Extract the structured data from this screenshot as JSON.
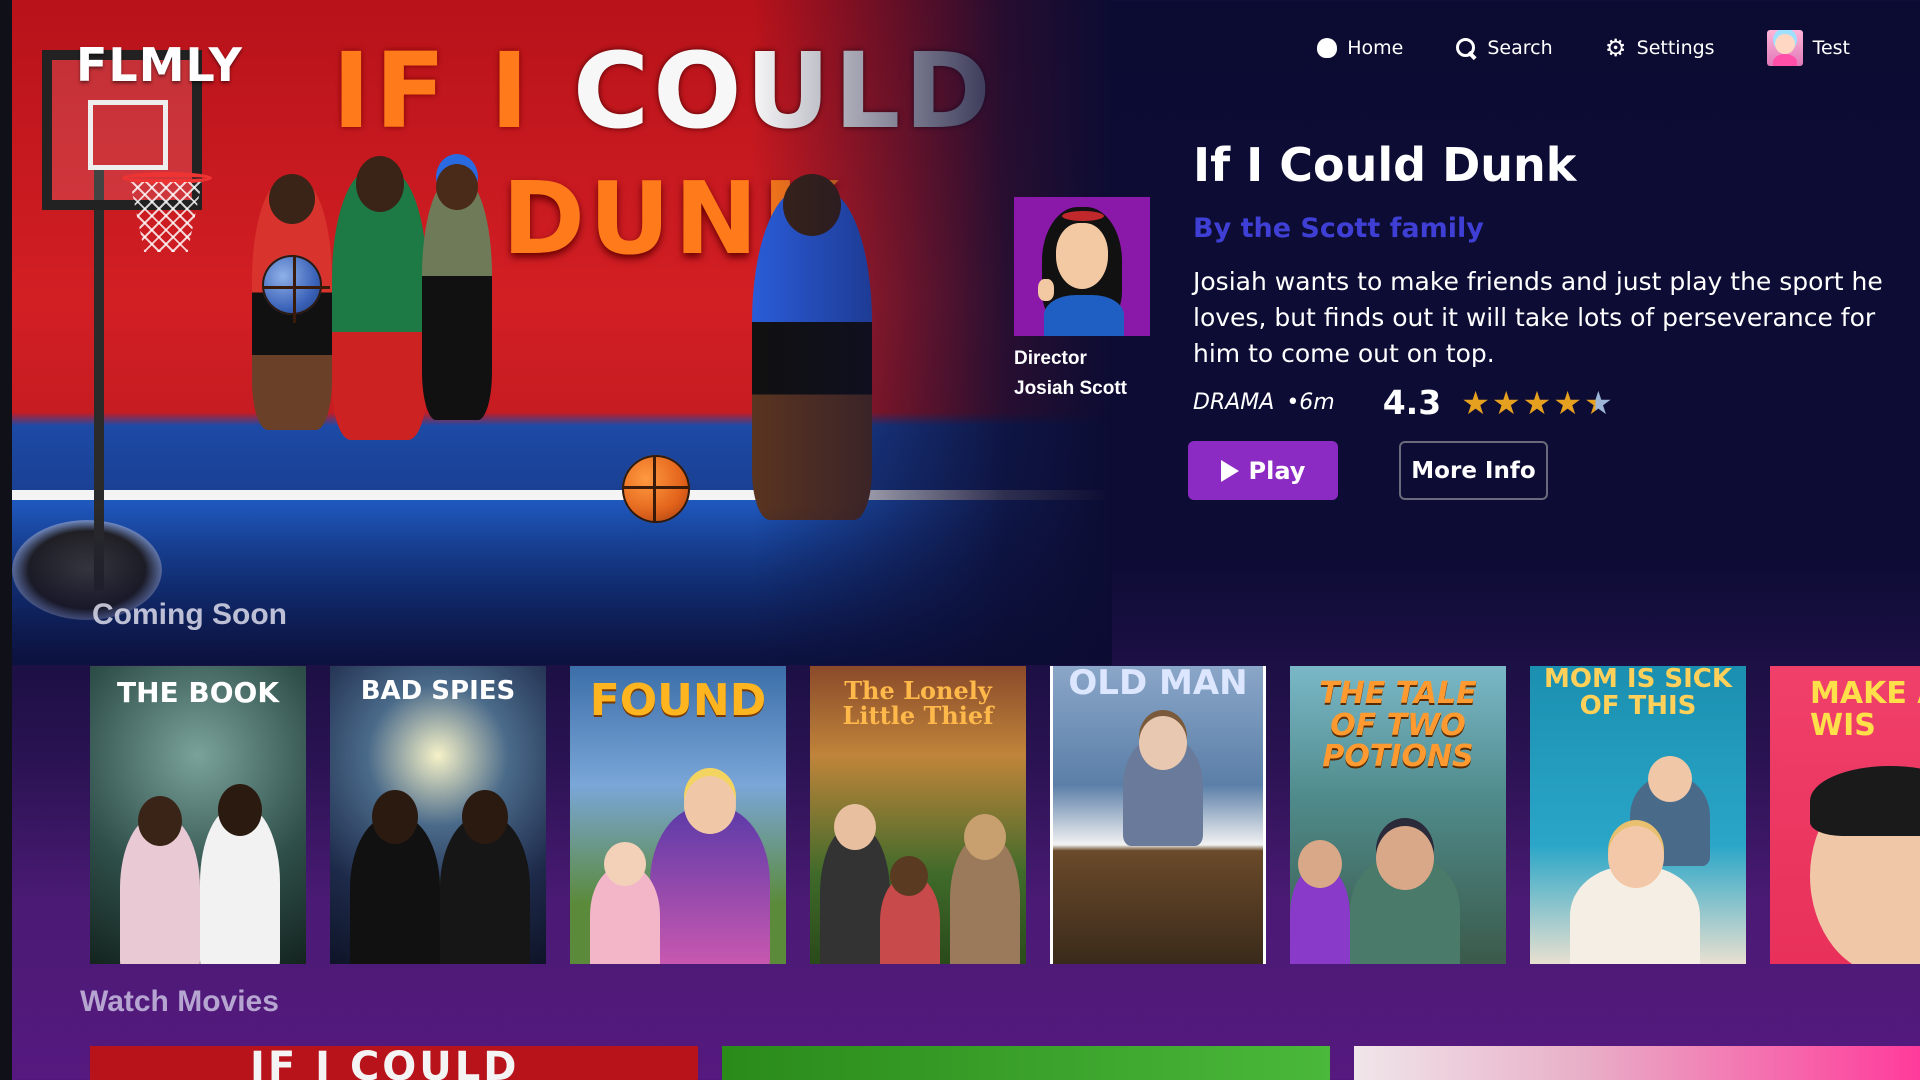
{
  "app": {
    "logo": "FLMLY"
  },
  "nav": [
    {
      "label": "Home",
      "icon": "home-icon"
    },
    {
      "label": "Search",
      "icon": "search-icon"
    },
    {
      "label": "Settings",
      "icon": "gear-icon"
    },
    {
      "label": "Test",
      "icon": "avatar"
    }
  ],
  "hero": {
    "art_title_line1": "IF I COULD",
    "art_title_line2": "DUNK",
    "coming_soon": "Coming Soon"
  },
  "details": {
    "title": "If I Could Dunk",
    "byline": "By the Scott family",
    "description": "Josiah wants to make friends and just play the sport he loves, but finds out it will take lots of perseverance for him to come out on top.",
    "genre": "DRAMA",
    "runtime": "•6m",
    "rating": "4.3",
    "rating_value": 4.3,
    "rating_max": 5,
    "director_role": "Director",
    "director_name": "Josiah Scott",
    "play_label": "Play",
    "more_info_label": "More Info"
  },
  "posters": [
    {
      "title": "THE BOOK",
      "bg": "#2f4f4a"
    },
    {
      "title": "BAD SPIES",
      "bg": "#1e2a4a"
    },
    {
      "title": "FOUND",
      "bg": "#3b6ea8"
    },
    {
      "title": "The Lonely Little Thief",
      "bg": "#6b4a2c"
    },
    {
      "title": "OLD MAN",
      "bg": "#5b7fa8"
    },
    {
      "title": "THE TALE OF TWO POTIONS",
      "bg": "#4f8a8a"
    },
    {
      "title": "MOM IS SICK OF THIS",
      "bg": "#1b8fb0"
    },
    {
      "title": "MAKE A WIS",
      "bg": "#e8305a"
    }
  ],
  "sections": {
    "watch_movies": "Watch Movies"
  },
  "bottom_row": [
    {
      "title": "IF I COULD",
      "bg": "#b8121a"
    },
    {
      "title": "",
      "bg": "#3aa32a"
    },
    {
      "title": "",
      "bg": "#f0e6ea"
    }
  ],
  "colors": {
    "accent": "#8c2bc4",
    "byline": "#3f3fd6",
    "background": "#0c0c33",
    "star": "#e6a020"
  }
}
